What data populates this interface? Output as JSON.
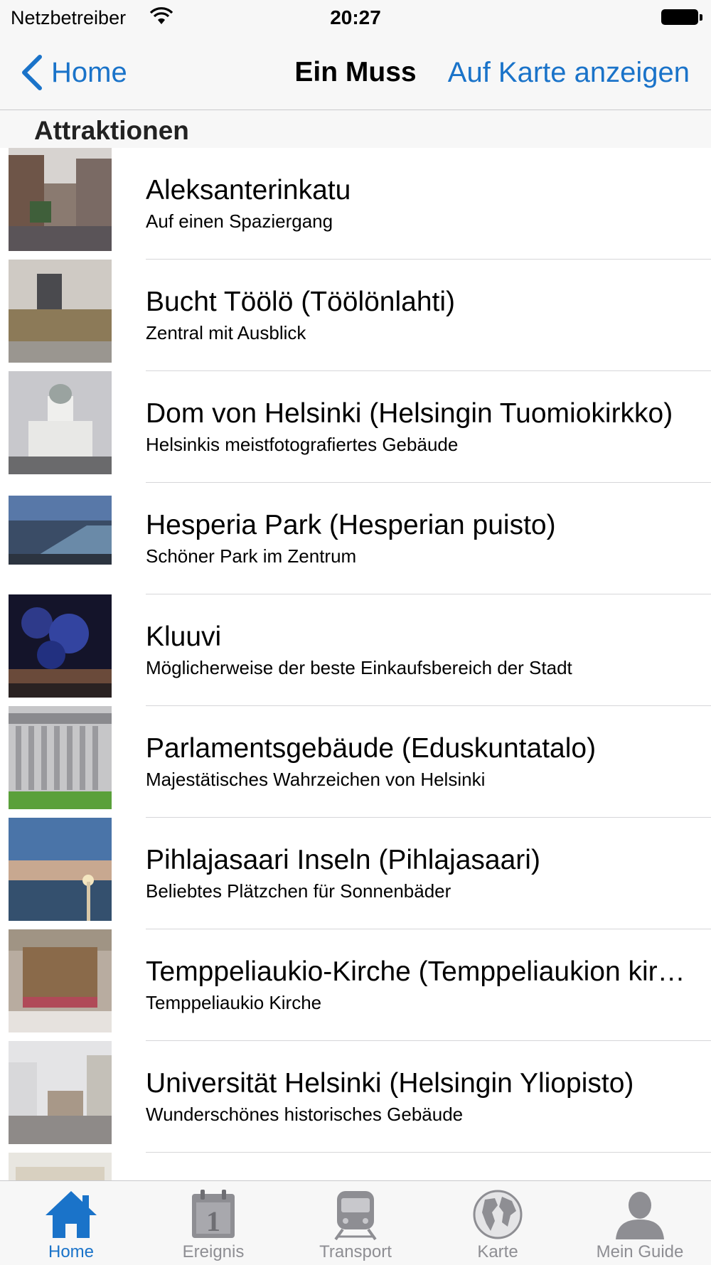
{
  "status_bar": {
    "carrier": "Netzbetreiber",
    "time": "20:27"
  },
  "nav": {
    "back_label": "Home",
    "title": "Ein Muss",
    "right_button": "Auf Karte anzeigen"
  },
  "section": {
    "title": "Attraktionen"
  },
  "items": [
    {
      "title": "Aleksanterinkatu",
      "subtitle": "Auf einen Spaziergang"
    },
    {
      "title": "Bucht Töölö (Töölönlahti)",
      "subtitle": "Zentral mit Ausblick"
    },
    {
      "title": "Dom von Helsinki  (Helsingin Tuomiokirkko)",
      "subtitle": "Helsinkis meistfotografiertes Gebäude"
    },
    {
      "title": "Hesperia Park (Hesperian puisto)",
      "subtitle": "Schöner Park im Zentrum"
    },
    {
      "title": "Kluuvi",
      "subtitle": "Möglicherweise der beste Einkaufsbereich der Stadt"
    },
    {
      "title": "Parlamentsgebäude (Eduskuntatalo)",
      "subtitle": "Majestätisches Wahrzeichen von Helsinki"
    },
    {
      "title": "Pihlajasaari Inseln (Pihlajasaari)",
      "subtitle": "Beliebtes Plätzchen für Sonnenbäder"
    },
    {
      "title": "Temppeliaukio-Kirche (Temppeliaukion kirkko)",
      "subtitle": "Temppeliaukio Kirche"
    },
    {
      "title": "Universität Helsinki (Helsingin Yliopisto)",
      "subtitle": "Wunderschönes historisches Gebäude"
    },
    {
      "title": "",
      "subtitle": ""
    }
  ],
  "tabs": [
    {
      "label": "Home",
      "icon": "home-icon",
      "active": true
    },
    {
      "label": "Ereignis",
      "icon": "calendar-icon",
      "active": false
    },
    {
      "label": "Transport",
      "icon": "train-icon",
      "active": false
    },
    {
      "label": "Karte",
      "icon": "globe-icon",
      "active": false
    },
    {
      "label": "Mein Guide",
      "icon": "person-icon",
      "active": false
    }
  ],
  "colors": {
    "accent": "#1a73c9",
    "inactive": "#8e8e93",
    "bar_background": "#f7f7f7"
  }
}
